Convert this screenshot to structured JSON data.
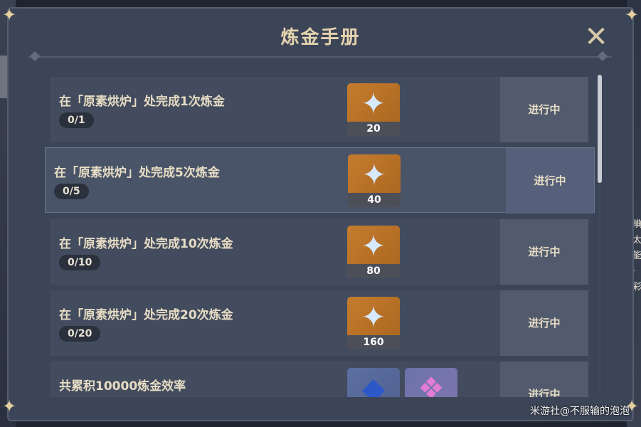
{
  "title": "炼金手册",
  "tasks": [
    {
      "title": "在「原素烘炉」处完成1次炼金",
      "progress": "0/1",
      "reward": "20",
      "status": "进行中"
    },
    {
      "title": "在「原素烘炉」处完成5次炼金",
      "progress": "0/5",
      "reward": "40",
      "status": "进行中"
    },
    {
      "title": "在「原素烘炉」处完成10次炼金",
      "progress": "0/10",
      "reward": "80",
      "status": "进行中"
    },
    {
      "title": "在「原素烘炉」处完成20次炼金",
      "progress": "0/20",
      "reward": "160",
      "status": "进行中"
    },
    {
      "title": "共累积10000炼金效率",
      "status": "进行中"
    }
  ],
  "watermark": "米游社@不服输的泡泡",
  "background_text": [
    "睓",
    "太",
    "能",
    "·彩"
  ],
  "icons": {
    "close": "close-x-icon",
    "reward": "primogem-icon",
    "reward_extra_1": "blue-crystal-icon",
    "reward_extra_2": "pink-crystal-icon"
  }
}
